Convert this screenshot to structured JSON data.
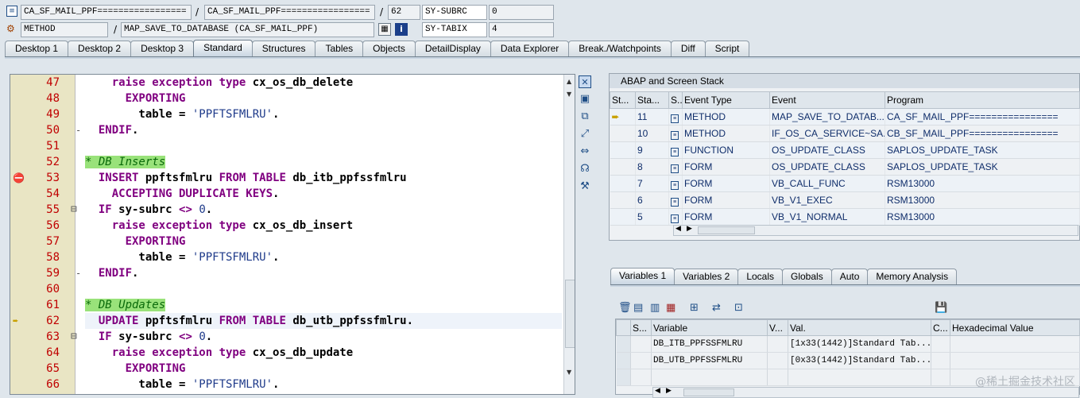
{
  "header": {
    "row1": {
      "program": "CA_SF_MAIL_PPF=================",
      "include": "CA_SF_MAIL_PPF=================",
      "line": "62",
      "sysvar1_name": "SY-SUBRC",
      "sysvar1_val": "0"
    },
    "row2": {
      "kind": "METHOD",
      "event": "MAP_SAVE_TO_DATABASE (CA_SF_MAIL_PPF)",
      "sysvar2_name": "SY-TABIX",
      "sysvar2_val": "4"
    }
  },
  "tabs": [
    "Desktop 1",
    "Desktop 2",
    "Desktop 3",
    "Standard",
    "Structures",
    "Tables",
    "Objects",
    "DetailDisplay",
    "Data Explorer",
    "Break./Watchpoints",
    "Diff",
    "Script"
  ],
  "active_tab": "Standard",
  "code_lines": [
    {
      "no": "47",
      "html": "    <span class=\"kw\">raise exception type</span> cx_os_db_delete"
    },
    {
      "no": "48",
      "html": "      <span class=\"kw\">EXPORTING</span>"
    },
    {
      "no": "49",
      "html": "        table = <span class=\"str\">'PPFTSFMLRU'</span>."
    },
    {
      "no": "50",
      "html": "  <span class=\"kw\">ENDIF</span>."
    },
    {
      "no": "51",
      "html": ""
    },
    {
      "no": "52",
      "html": "<span class=\"cmt\">* DB Inserts</span>"
    },
    {
      "no": "53",
      "html": "  <span class=\"kw\">INSERT</span> ppftsfmlru <span class=\"kw\">FROM TABLE</span> db_itb_ppfssfmlru"
    },
    {
      "no": "54",
      "html": "    <span class=\"kw\">ACCEPTING DUPLICATE KEYS</span>."
    },
    {
      "no": "55",
      "html": "  <span class=\"kw\">IF</span> sy-subrc <span class=\"kw\">&lt;&gt;</span> <span class=\"num\">0</span>."
    },
    {
      "no": "56",
      "html": "    <span class=\"kw\">raise exception type</span> cx_os_db_insert"
    },
    {
      "no": "57",
      "html": "      <span class=\"kw\">EXPORTING</span>"
    },
    {
      "no": "58",
      "html": "        table = <span class=\"str\">'PPFTSFMLRU'</span>."
    },
    {
      "no": "59",
      "html": "  <span class=\"kw\">ENDIF</span>."
    },
    {
      "no": "60",
      "html": ""
    },
    {
      "no": "61",
      "html": "<span class=\"cmt\">* DB Updates</span>"
    },
    {
      "no": "62",
      "html": "  <span class=\"kw\">UPDATE</span> ppftsfmlru <span class=\"kw\">FROM TABLE</span> db_utb_ppfssfmlru."
    },
    {
      "no": "63",
      "html": "  <span class=\"kw\">IF</span> sy-subrc <span class=\"kw\">&lt;&gt;</span> <span class=\"num\">0</span>."
    },
    {
      "no": "64",
      "html": "    <span class=\"kw\">raise exception type</span> cx_os_db_update"
    },
    {
      "no": "65",
      "html": "      <span class=\"kw\">EXPORTING</span>"
    },
    {
      "no": "66",
      "html": "        table = <span class=\"str\">'PPFTSFMLRU'</span>."
    }
  ],
  "stack": {
    "title": "ABAP and Screen Stack",
    "cols": [
      "St...",
      "Sta...",
      "S...",
      "Event Type",
      "Event",
      "Program"
    ],
    "rows": [
      [
        "11",
        "METHOD",
        "MAP_SAVE_TO_DATAB...",
        "CA_SF_MAIL_PPF================"
      ],
      [
        "10",
        "METHOD",
        "IF_OS_CA_SERVICE~SA...",
        "CB_SF_MAIL_PPF================"
      ],
      [
        "9",
        "FUNCTION",
        "OS_UPDATE_CLASS",
        "SAPLOS_UPDATE_TASK"
      ],
      [
        "8",
        "FORM",
        "OS_UPDATE_CLASS",
        "SAPLOS_UPDATE_TASK"
      ],
      [
        "7",
        "FORM",
        "VB_CALL_FUNC",
        "RSM13000"
      ],
      [
        "6",
        "FORM",
        "VB_V1_EXEC",
        "RSM13000"
      ],
      [
        "5",
        "FORM",
        "VB_V1_NORMAL",
        "RSM13000"
      ]
    ]
  },
  "var_tabs": [
    "Variables 1",
    "Variables 2",
    "Locals",
    "Globals",
    "Auto",
    "Memory Analysis"
  ],
  "vars": {
    "cols": [
      "S...",
      "Variable",
      "V...",
      "Val.",
      "C...",
      "Hexadecimal Value"
    ],
    "rows": [
      [
        "DB_ITB_PPFSSFMLRU",
        "[1x33(1442)]Standard Tab..."
      ],
      [
        "DB_UTB_PPFSSFMLRU",
        "[0x33(1442)]Standard Tab..."
      ]
    ]
  },
  "watermark": "@稀土掘金技术社区"
}
